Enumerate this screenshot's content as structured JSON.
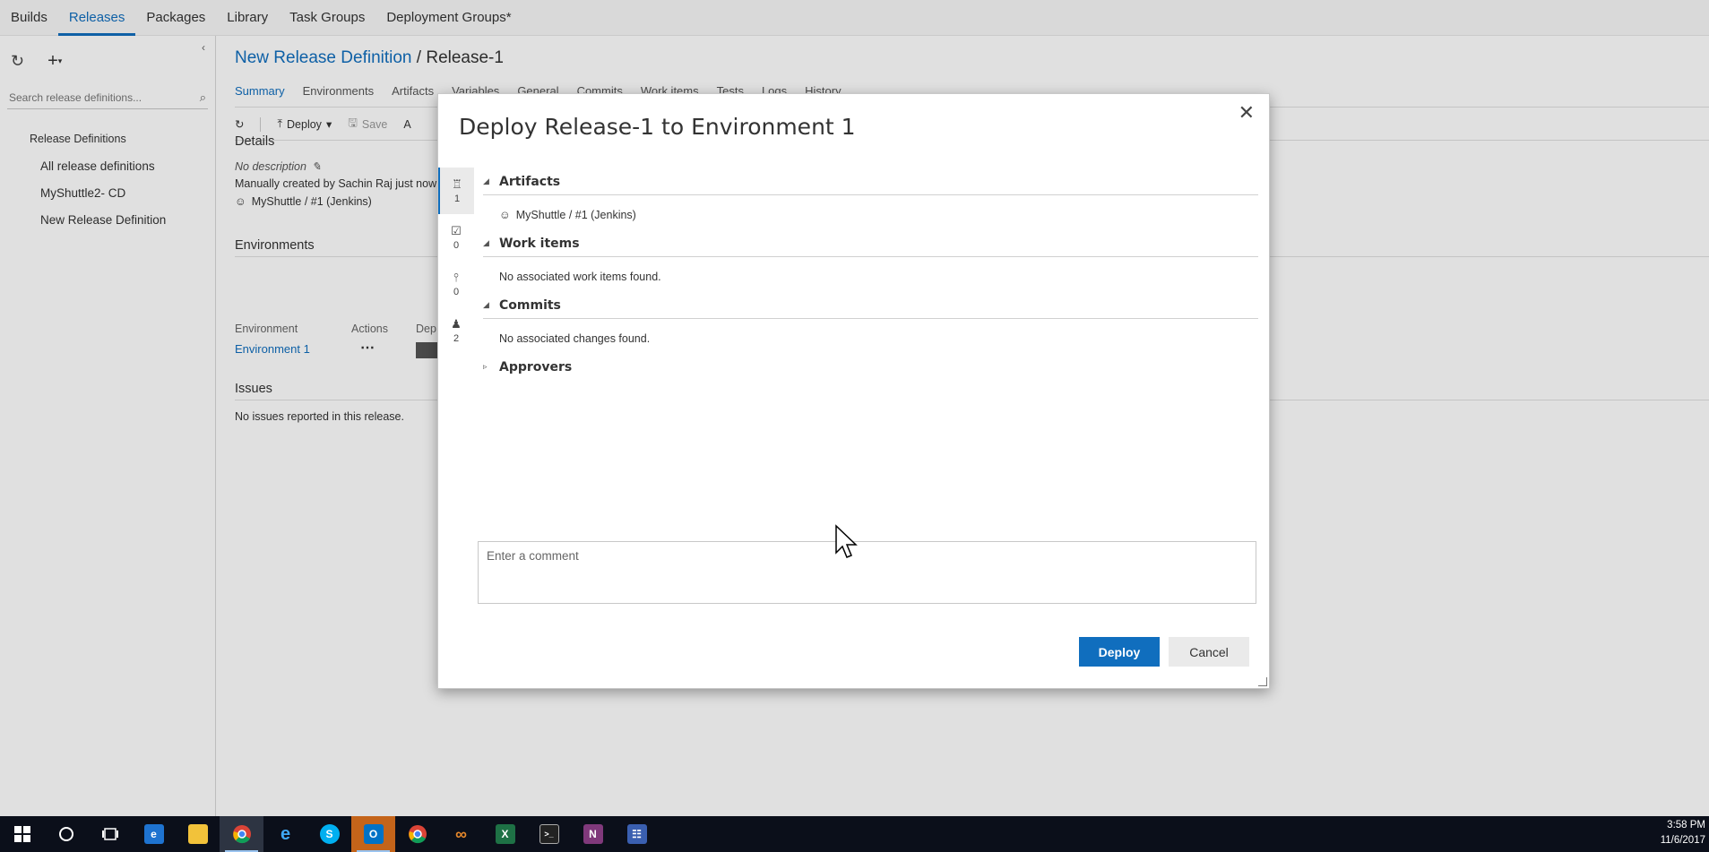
{
  "hub": {
    "tabs": [
      "Builds",
      "Releases",
      "Packages",
      "Library",
      "Task Groups",
      "Deployment Groups*"
    ],
    "active": "Releases"
  },
  "left_panel": {
    "search_placeholder": "Search release definitions...",
    "tree_header": "Release Definitions",
    "items": [
      "All release definitions",
      "MyShuttle2- CD",
      "New Release Definition"
    ]
  },
  "main": {
    "breadcrumb_link": "New Release Definition",
    "breadcrumb_sep": "/",
    "breadcrumb_current": "Release-1",
    "pivots": [
      "Summary",
      "Environments",
      "Artifacts",
      "Variables",
      "General",
      "Commits",
      "Work items",
      "Tests",
      "Logs",
      "History"
    ],
    "toolbar": {
      "deploy_label": "Deploy",
      "save_label": "Save",
      "more_label": "A"
    },
    "details": {
      "title": "Details",
      "description": "No description",
      "created": "Manually created by Sachin Raj just now",
      "artifact": "MyShuttle / #1 (Jenkins)"
    },
    "environments": {
      "title": "Environments",
      "columns": [
        "Environment",
        "Actions",
        "Dep"
      ],
      "row": {
        "name": "Environment 1",
        "actions": "⋯"
      }
    },
    "issues": {
      "title": "Issues",
      "text": "No issues reported in this release."
    }
  },
  "dialog": {
    "title": "Deploy Release-1 to Environment 1",
    "rail": [
      {
        "icon": "artifacts-icon",
        "count": "1"
      },
      {
        "icon": "work-items-icon",
        "count": "0"
      },
      {
        "icon": "commits-icon",
        "count": "0"
      },
      {
        "icon": "approvers-icon",
        "count": "2"
      }
    ],
    "sections": {
      "artifacts": {
        "title": "Artifacts",
        "line": "MyShuttle / #1 (Jenkins)"
      },
      "work_items": {
        "title": "Work items",
        "line": "No associated work items found."
      },
      "commits": {
        "title": "Commits",
        "line": "No associated changes found."
      },
      "approvers": {
        "title": "Approvers"
      }
    },
    "comment_placeholder": "Enter a comment",
    "deploy_label": "Deploy",
    "cancel_label": "Cancel"
  },
  "taskbar": {
    "time": "3:58 PM",
    "date": "11/6/2017"
  },
  "colors": {
    "accent": "#106ebe",
    "taskbar": "#0b0f1a"
  }
}
